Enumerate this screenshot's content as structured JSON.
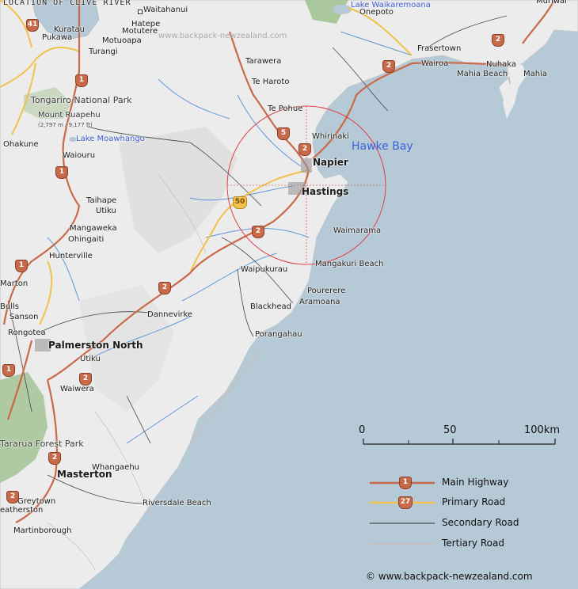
{
  "header": {
    "title": "LOCATION OF CLIVE RIVER"
  },
  "watermark": "www.backpack-newzealand.com",
  "water_labels": {
    "hawke_bay": "Hawke Bay",
    "lake_waikaremoana": "Lake Waikaremoana",
    "lake_moawhango": "Lake Moawhango"
  },
  "parks": {
    "tongariro": "Tongariro National Park",
    "tararua": "Tararua Forest Park"
  },
  "mountain": {
    "name": "Mount Ruapehu",
    "elevation": "(2,797 m / 9,177 ft)"
  },
  "places": {
    "waitahanui": "Waitahanui",
    "kuratau": "Kuratau",
    "hatepe": "Hatepe",
    "motutere": "Motutere",
    "pukawa": "Pukawa",
    "motuoapa": "Motuoapa",
    "turangi": "Turangi",
    "tarawera": "Tarawera",
    "te_haroto": "Te Haroto",
    "te_pohue": "Te Pohue",
    "whirinaki": "Whirinaki",
    "napier": "Napier",
    "hastings": "Hastings",
    "waimarama": "Waimarama",
    "mangakuri_beach": "Mangakuri Beach",
    "waipukurau": "Waipukurau",
    "pourerere": "Pourerere",
    "aramoana": "Aramoana",
    "blackhead": "Blackhead",
    "porangahau": "Porangahau",
    "dannevirke": "Dannevirke",
    "ohakune": "Ohakune",
    "waiouru": "Waiouru",
    "taihape": "Taihape",
    "utiku": "Utiku",
    "mangaweka": "Mangaweka",
    "ohingaiti": "Ohingaiti",
    "hunterville": "Hunterville",
    "marton": "Marton",
    "bulls": "Bulls",
    "sanson": "Sanson",
    "rongotea": "Rongotea",
    "palmerston_north": "Palmerston North",
    "utiku2": "Utiku",
    "waiwera": "Waiwera",
    "whangaehu": "Whangaehu",
    "masterton": "Masterton",
    "greytown": "Greytown",
    "featherston": "eatherston",
    "martinborough": "Martinborough",
    "riversdale_beach": "Riversdale Beach",
    "onepoto": "Onepoto",
    "frasertown": "Frasertown",
    "wairoa": "Wairoa",
    "nuhaka": "Nuhaka",
    "mahia_beach": "Mahia Beach",
    "mahia": "Mahia",
    "muriwai": "Muriwai"
  },
  "road_shields": {
    "s41": "41",
    "s1a": "1",
    "s5a": "5",
    "s2a": "2",
    "s2b": "2",
    "s50": "50",
    "s2c": "2",
    "s1b": "1",
    "s1c": "1",
    "s2d": "2",
    "s2e": "2",
    "s2f": "2",
    "s2g": "2",
    "s1d": "1",
    "s2h": "2"
  },
  "scale": {
    "ticks": [
      "0",
      "50",
      "100km"
    ]
  },
  "legend": {
    "main_highway": {
      "label": "Main Highway",
      "shield": "1",
      "color": "#c86a4a"
    },
    "primary_road": {
      "label": "Primary Road",
      "shield": "27",
      "color": "#f0c24a"
    },
    "secondary_road": {
      "label": "Secondary Road",
      "color": "#333333"
    },
    "tertiary_road": {
      "label": "Tertiary Road",
      "color": "#d8b8a8"
    }
  },
  "copyright": "© www.backpack-newzealand.com",
  "colors": {
    "sea": "#b6c9d6",
    "land": "#ececec",
    "forest": "#9bbf8a",
    "river": "#4b8ad6",
    "circle": "#e0404a"
  }
}
